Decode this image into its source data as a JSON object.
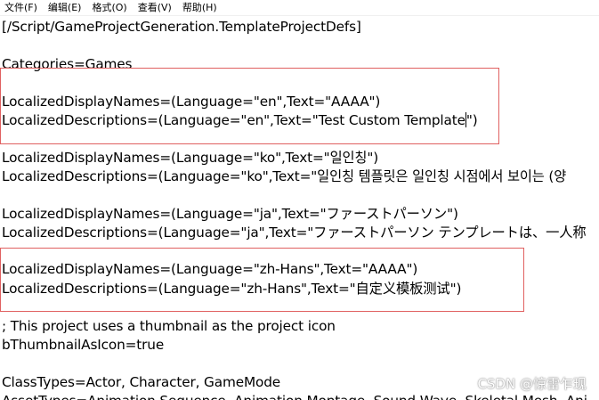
{
  "menu": {
    "file": "文件(F)",
    "edit": "编辑(E)",
    "format": "格式(O)",
    "view": "查看(V)",
    "help": "帮助(H)"
  },
  "lines": {
    "section": "[/Script/GameProjectGeneration.TemplateProjectDefs]",
    "categories": "Categories=Games",
    "en_name": "LocalizedDisplayNames=(Language=\"en\",Text=\"AAAA\")",
    "en_desc_before_caret": "LocalizedDescriptions=(Language=\"en\",Text=\"Test Custom Template",
    "en_desc_after_caret": "\")",
    "ko_name": "LocalizedDisplayNames=(Language=\"ko\",Text=\"일인칭\")",
    "ko_desc": "LocalizedDescriptions=(Language=\"ko\",Text=\"일인칭 템플릿은 일인칭 시점에서 보이는 (양",
    "ja_name": "LocalizedDisplayNames=(Language=\"ja\",Text=\"ファーストパーソン\")",
    "ja_desc": "LocalizedDescriptions=(Language=\"ja\",Text=\"ファーストパーソン テンプレートは、一人称",
    "zh_name": "LocalizedDisplayNames=(Language=\"zh-Hans\",Text=\"AAAA\")",
    "zh_desc": "LocalizedDescriptions=(Language=\"zh-Hans\",Text=\"自定义模板测试\")",
    "comment": "; This project uses a thumbnail as the project icon",
    "thumbnail": "bThumbnailAsIcon=true",
    "class_types": "ClassTypes=Actor, Character, GameMode",
    "asset_types": "AssetTypes=Animation Sequence, Animation Montage, Sound Wave, Skeletal Mesh, Ani"
  },
  "watermark": "CSDN @惊雷乍现",
  "colors": {
    "highlight_border": "#e06060"
  }
}
